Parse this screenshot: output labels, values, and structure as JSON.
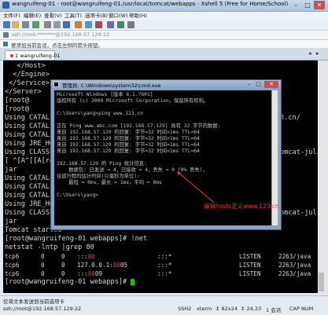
{
  "window": {
    "title": "wangruifeng-01 - root@wangruifeng-01:/usr/local/tomcat/webapps - Xshell 5 (Free for Home/School)",
    "min": "–",
    "max": "□",
    "close": "✕"
  },
  "menu": [
    "文件(F)",
    "编辑(E)",
    "查看(V)",
    "工具(T)",
    "选项卡(B)",
    "窗口(W)",
    "帮助(H)"
  ],
  "address": {
    "text": "ssh://root:*******@192.168.57.129:22"
  },
  "hint": {
    "text": "要添加当前会话，点击左侧的箭头按钮。"
  },
  "tabs": [
    {
      "label": "1 wangruifeng-01"
    }
  ],
  "terminal": {
    "lines": [
      "   </Host>",
      "  </Engine>",
      " </Service>",
      "</Server>",
      "[root@",
      "[root@",
      "Using CATALINA",
      "Using CATALINA",
      "Using CATALINA",
      "Using JRE_HOME",
      "Using CLASSPATH",
      "[ ^[A^[[A[root@",
      "jar",
      "Using CATALINA",
      "Using CATALINA",
      "Using CATALINA",
      "Using JRE_HOME",
      "Using CLASSPATH",
      "jar",
      "Tomcat started",
      "[root@wangruifeng-01 webapps]# !net",
      "netstat -lntp |grep 80"
    ],
    "right_fragments": [
      {
        "row": 6,
        "text": "3.cn/"
      },
      {
        "row": 10,
        "text": "omcat-juli"
      },
      {
        "row": 17,
        "text": "omcat-juli"
      }
    ],
    "netstat": [
      {
        "proto": "tcp6",
        "recv": "0",
        "send": "0",
        "local_pre": ":::",
        "local_hl": "80",
        "local_post": "",
        "foreign": ":::*",
        "state": "LISTEN",
        "pid": "2263/java"
      },
      {
        "proto": "tcp6",
        "recv": "0",
        "send": "0",
        "local_pre": "127.0.0.1:",
        "local_hl": "80",
        "local_post": "05",
        "foreign": ":::*",
        "state": "LISTEN",
        "pid": "2263/java"
      },
      {
        "proto": "tcp6",
        "recv": "0",
        "send": "0",
        "local_pre": ":::",
        "local_hl": "80",
        "local_post": "09",
        "foreign": ":::*",
        "state": "LISTEN",
        "pid": "2263/java"
      }
    ],
    "prompt": "[root@wangruifeng-01 webapps]# "
  },
  "cmd": {
    "title": "管理员: C:\\Windows\\system32\\cmd.exe",
    "lines": [
      "Microsoft Windows [版本 6.1.7601]",
      "版权所有 (c) 2009 Microsoft Corporation。保留所有权利。",
      "",
      "C:\\Users\\yang>ping www.123.cn",
      "",
      "正在 Ping www.abc.com [192.168.57.129] 具有 32 字节的数据:",
      "来自 192.168.57.129 的回复: 字节=32 时间<1ms TTL=64",
      "来自 192.168.57.129 的回复: 字节=32 时间=1ms TTL=64",
      "来自 192.168.57.129 的回复: 字节=32 时间=1ms TTL=64",
      "来自 192.168.57.129 的回复: 字节=32 时间<1ms TTL=64",
      "",
      "192.168.57.129 的 Ping 统计信息:",
      "    数据包: 已发送 = 4，已接收 = 4，丢失 = 0 (0% 丢失)，",
      "往返行程的估计时间(以毫秒为单位):",
      "    最短 = 0ms，最长 = 1ms，平均 = 0ms",
      "",
      "C:\\Users\\yang>"
    ]
  },
  "annotation": {
    "text": "编辑hosts定义www.123.cn",
    "color": "#e8392f"
  },
  "status": {
    "line1": "仅将文本发送到当前选项卡",
    "line2": "ssh://root@192.168.57.129:22",
    "right": [
      "SSH2",
      "xterm",
      "↕ 82x24",
      "↕ 24,33",
      "1 会话",
      "CAP NUM"
    ]
  }
}
